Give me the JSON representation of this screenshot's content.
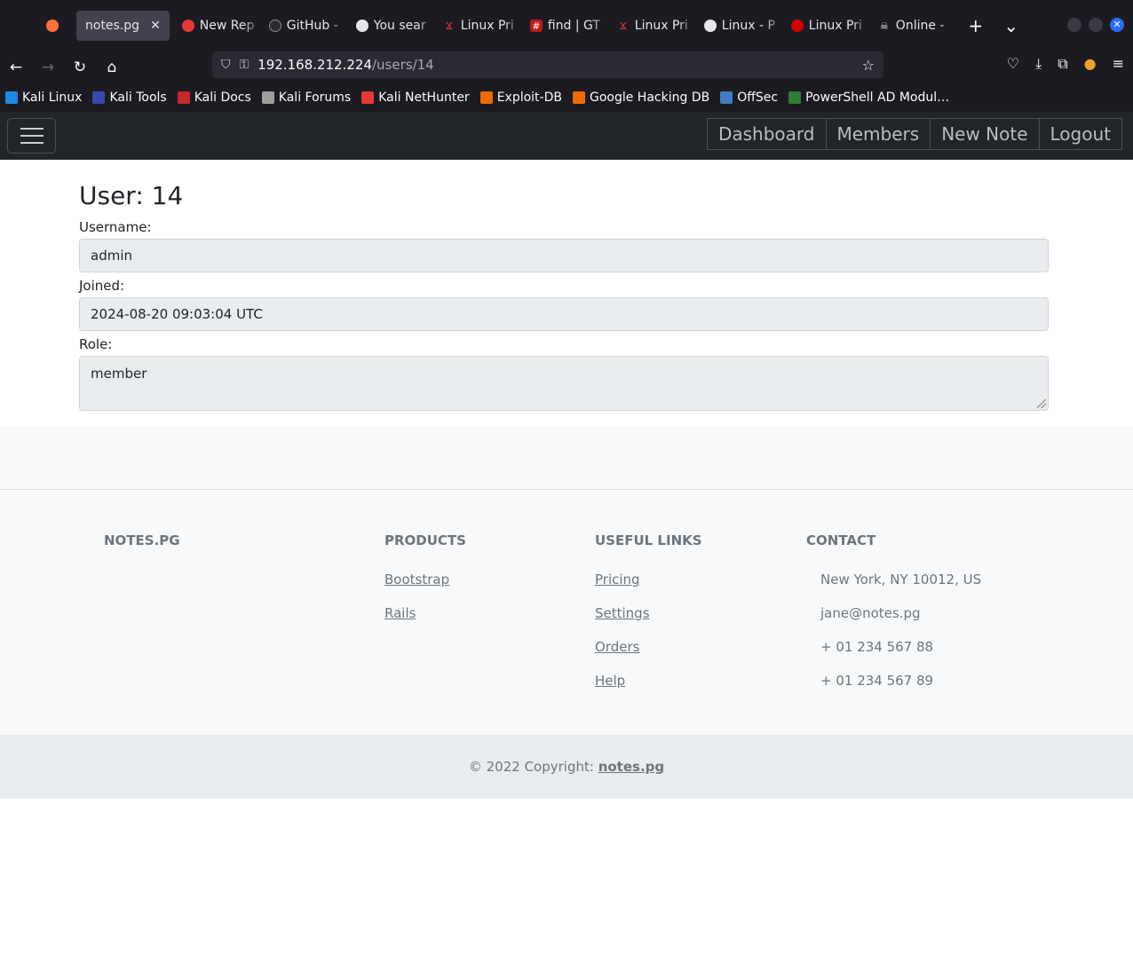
{
  "browser": {
    "tabs": [
      {
        "label": "notes.pg",
        "icon": "close-icon",
        "active": true
      },
      {
        "label": "New Rep",
        "icon": "red-circle-icon"
      },
      {
        "label": "GitHub -",
        "icon": "github-icon"
      },
      {
        "label": "You sear",
        "icon": "wordpress-icon"
      },
      {
        "label": "Linux Pri",
        "icon": "hacktricks-icon"
      },
      {
        "label": "find | GT",
        "icon": "gtfobins-icon"
      },
      {
        "label": "Linux Pri",
        "icon": "hacktricks-icon"
      },
      {
        "label": "Linux - P",
        "icon": "linux-icon"
      },
      {
        "label": "Linux Pri",
        "icon": "red-dot-icon"
      },
      {
        "label": "Online -",
        "icon": "skull-icon"
      }
    ],
    "url_host": "192.168.212.224",
    "url_path": "/users/14",
    "bookmarks": [
      {
        "label": "Kali Linux",
        "color": "#1e88e5"
      },
      {
        "label": "Kali Tools",
        "color": "#3949ab"
      },
      {
        "label": "Kali Docs",
        "color": "#c62828"
      },
      {
        "label": "Kali Forums",
        "color": "#9e9e9e"
      },
      {
        "label": "Kali NetHunter",
        "color": "#e53935"
      },
      {
        "label": "Exploit-DB",
        "color": "#ef6c00"
      },
      {
        "label": "Google Hacking DB",
        "color": "#ef6c00"
      },
      {
        "label": "OffSec",
        "color": "#3f7cc1"
      },
      {
        "label": "PowerShell AD Modul…",
        "color": "#2e7d32"
      }
    ]
  },
  "appnav": {
    "links": [
      "Dashboard",
      "Members",
      "New Note",
      "Logout"
    ]
  },
  "user": {
    "title": "User: 14",
    "username_label": "Username:",
    "username": "admin",
    "joined_label": "Joined:",
    "joined": "2024-08-20 09:03:04 UTC",
    "role_label": "Role:",
    "role": "member"
  },
  "footer": {
    "brand": "NOTES.PG",
    "products_title": "PRODUCTS",
    "products": [
      "Bootstrap",
      "Rails"
    ],
    "links_title": "USEFUL LINKS",
    "links": [
      "Pricing",
      "Settings",
      "Orders",
      "Help"
    ],
    "contact_title": "CONTACT",
    "contact": [
      "New York, NY 10012, US",
      "jane@notes.pg",
      "+ 01 234 567 88",
      "+ 01 234 567 89"
    ],
    "copyright_prefix": "© 2022 Copyright: ",
    "copyright_link": "notes.pg"
  }
}
